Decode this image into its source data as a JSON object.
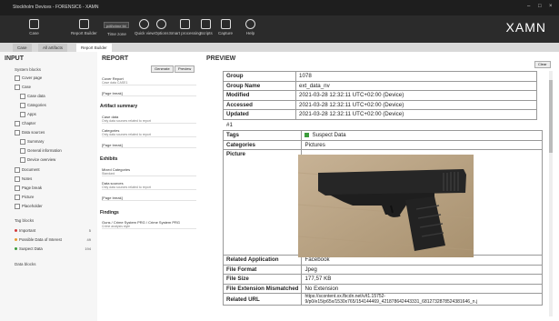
{
  "app": {
    "title": "Stockholm Devices - FORENSIC6 - XAMN",
    "brand": "XAMN"
  },
  "toolbar": {
    "items": [
      {
        "label": "Case"
      },
      {
        "label": "Report Builder"
      },
      {
        "label": "Time zone"
      },
      {
        "label": "Quick view"
      },
      {
        "label": "Options"
      },
      {
        "label": "Smart processing"
      },
      {
        "label": "Scripts"
      },
      {
        "label": "Capture"
      },
      {
        "label": "Help"
      }
    ],
    "timezone_value": "pdf/crime tbl"
  },
  "tabs": [
    {
      "label": "Case"
    },
    {
      "label": "All artifacts"
    },
    {
      "label": "Report Builder"
    }
  ],
  "input": {
    "header": "INPUT",
    "system_blocks_header": "System blocks",
    "items": [
      {
        "label": "Cover page"
      },
      {
        "label": "Case"
      },
      {
        "label": "Case data"
      },
      {
        "label": "Categories"
      },
      {
        "label": "Apps"
      },
      {
        "label": "Chapter"
      },
      {
        "label": "Data sources"
      },
      {
        "label": "Summary"
      },
      {
        "label": "General information"
      },
      {
        "label": "Device overview"
      },
      {
        "label": "Document"
      },
      {
        "label": "Notes"
      },
      {
        "label": "Page break"
      },
      {
        "label": "Picture"
      },
      {
        "label": "Placeholder"
      }
    ],
    "tag_blocks_header": "Tag blocks",
    "tags": [
      {
        "label": "Important",
        "count": "5",
        "color": "#d23b3b"
      },
      {
        "label": "Possible Data of Interest",
        "count": "49",
        "color": "#e89a2c"
      },
      {
        "label": "Suspect Data",
        "count": "194",
        "color": "#3c9c3c"
      }
    ],
    "data_blocks_header": "Data blocks"
  },
  "report": {
    "header": "REPORT",
    "generate_label": "Generate",
    "preview_label": "Preview",
    "sections": [
      {
        "title": "",
        "items": [
          {
            "name": "Cover Report",
            "sub": "Case data CASE1"
          },
          {
            "name": "[Page break]",
            "sub": ""
          }
        ]
      },
      {
        "title": "Artifact summary",
        "items": [
          {
            "name": "Case data",
            "sub": "Only data sources related to report"
          },
          {
            "name": "Categories",
            "sub": "Only data sources related to report"
          },
          {
            "name": "[Page break]",
            "sub": ""
          }
        ]
      },
      {
        "title": "Exhibits",
        "items": [
          {
            "name": "Mixed Categories",
            "sub": "Standard"
          },
          {
            "name": "Data sources",
            "sub": "Only data sources related to report"
          },
          {
            "name": "[Page break]",
            "sub": ""
          }
        ]
      },
      {
        "title": "Findings",
        "items": [
          {
            "name": "Guns / Crime System PRG / Crime System PRG",
            "sub": "Crime analysis style"
          }
        ]
      }
    ]
  },
  "preview": {
    "header": "PREVIEW",
    "clear_label": "Clear",
    "top_rows": [
      {
        "key": "Group",
        "value": "1078"
      },
      {
        "key": "Group Name",
        "value": "ext_data_nv"
      },
      {
        "key": "Modified",
        "value": "2021-03-28 12:32:11 UTC+02:00 (Device)"
      },
      {
        "key": "Accessed",
        "value": "2021-03-28 12:32:11 UTC+02:00 (Device)"
      },
      {
        "key": "Updated",
        "value": "2021-03-28 12:32:11 UTC+02:00 (Device)"
      }
    ],
    "item_number": "#1",
    "tags_key": "Tags",
    "tags_value": "Suspect Data",
    "categories_key": "Categories",
    "categories_value": "Pictures",
    "picture_key": "Picture",
    "bottom_rows": [
      {
        "key": "Related Application",
        "value": "Facebook"
      },
      {
        "key": "File Format",
        "value": "Jpeg"
      },
      {
        "key": "File Size",
        "value": "177,57 KB"
      },
      {
        "key": "File Extension Mismatched",
        "value": "No Extension"
      },
      {
        "key": "Related URL",
        "value": "https://scontent.xx.fbcdn.net/v/t1.15752-9/p0/e15/p65x/1530x765/154144469_421878642443331_6812732878524381646_n.j"
      }
    ],
    "picture_subject": "handgun"
  }
}
